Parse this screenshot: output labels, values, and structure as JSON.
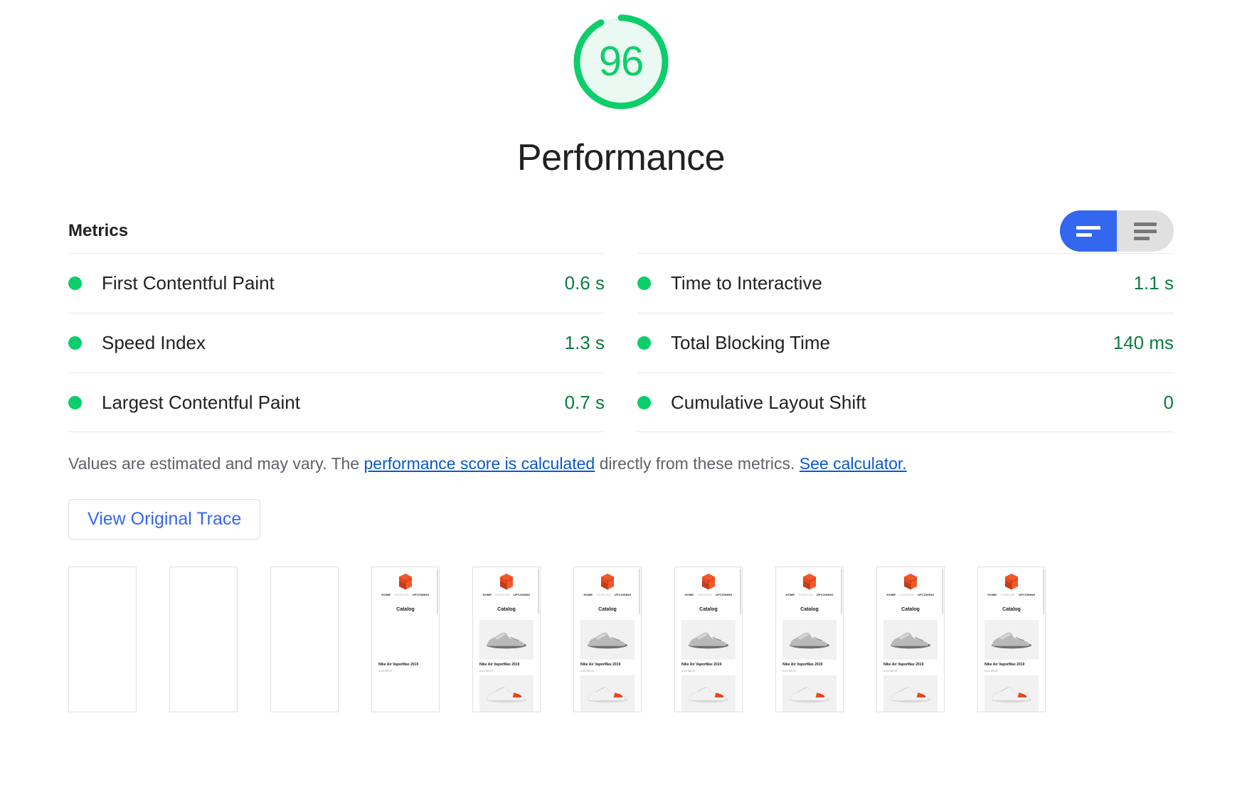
{
  "score": {
    "value": "96",
    "numeric": 96,
    "title": "Performance",
    "ring_color": "#0cce6b",
    "fill_color": "#eaf9f1"
  },
  "metrics_section": {
    "title": "Metrics",
    "toggle": {
      "options": [
        "simple-view",
        "expanded-view"
      ],
      "selected": "simple-view",
      "active_color": "#3367f0",
      "inactive_color": "#e0e0e0"
    },
    "left_column": [
      {
        "label": "First Contentful Paint",
        "value": "0.6 s",
        "status": "pass"
      },
      {
        "label": "Speed Index",
        "value": "1.3 s",
        "status": "pass"
      },
      {
        "label": "Largest Contentful Paint",
        "value": "0.7 s",
        "status": "pass"
      }
    ],
    "right_column": [
      {
        "label": "Time to Interactive",
        "value": "1.1 s",
        "status": "pass"
      },
      {
        "label": "Total Blocking Time",
        "value": "140 ms",
        "status": "pass"
      },
      {
        "label": "Cumulative Layout Shift",
        "value": "0",
        "status": "pass"
      }
    ],
    "pass_color": "#0cce6b",
    "value_color": "#0b7c3f"
  },
  "disclaimer": {
    "prefix": "Values are estimated and may vary. The ",
    "link1": "performance score is calculated",
    "middle": " directly from these metrics. ",
    "link2": "See calculator.",
    "link_color": "#0b57d0"
  },
  "trace_button": {
    "label": "View Original Trace"
  },
  "filmstrip": {
    "frames": [
      {
        "state": "blank"
      },
      {
        "state": "blank"
      },
      {
        "state": "blank"
      },
      {
        "state": "partial"
      },
      {
        "state": "loaded"
      },
      {
        "state": "loaded"
      },
      {
        "state": "loaded"
      },
      {
        "state": "loaded"
      },
      {
        "state": "loaded"
      },
      {
        "state": "loaded"
      }
    ],
    "page_preview": {
      "nav": [
        "HOME",
        "CATALOG",
        "UPCOMING"
      ],
      "heading": "Catalog",
      "product_title": "Nike Air VaporMax 2019",
      "product_price": "from $8.00",
      "logo_color": "#e8491d"
    }
  }
}
